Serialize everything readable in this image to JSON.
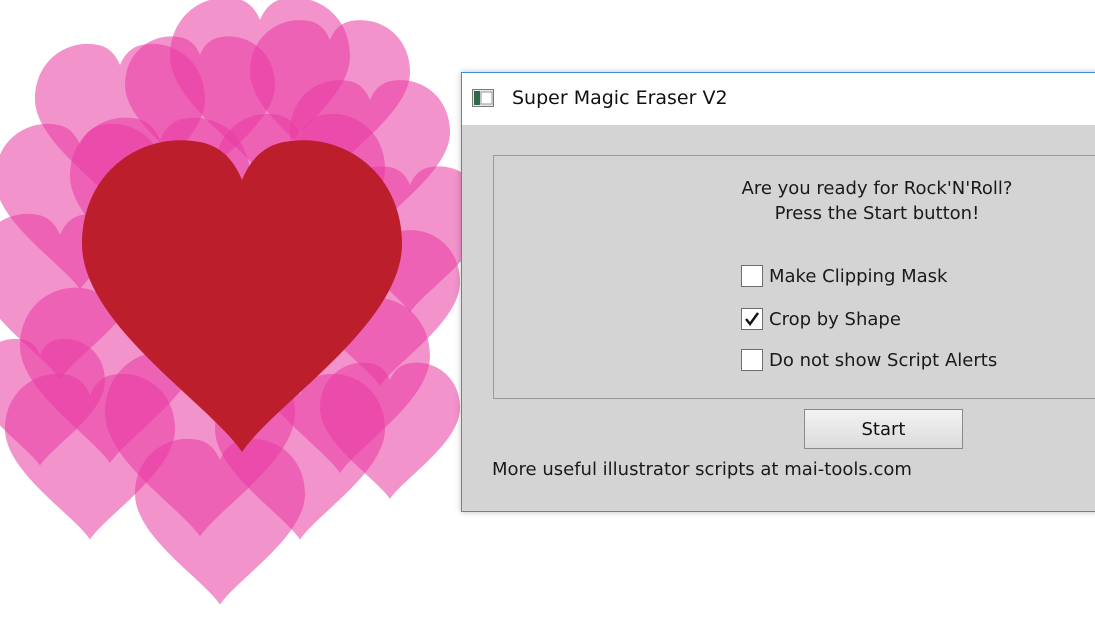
{
  "window": {
    "title": "Super Magic Eraser V2"
  },
  "dialog": {
    "intro_line1": "Are you ready for Rock'N'Roll?",
    "intro_line2": "Press the Start button!",
    "options": [
      {
        "label": "Make Clipping Mask",
        "checked": false
      },
      {
        "label": "Crop by Shape",
        "checked": true
      },
      {
        "label": "Do not show Script Alerts",
        "checked": false
      }
    ],
    "start_label": "Start",
    "footer_text": "More useful illustrator scripts at mai-tools.com"
  },
  "colors": {
    "background_hearts": "#ea3aa3",
    "center_heart": "#bc1e2b",
    "dialog_border": "#3a8fd6",
    "dialog_body": "#d4d4d4"
  }
}
